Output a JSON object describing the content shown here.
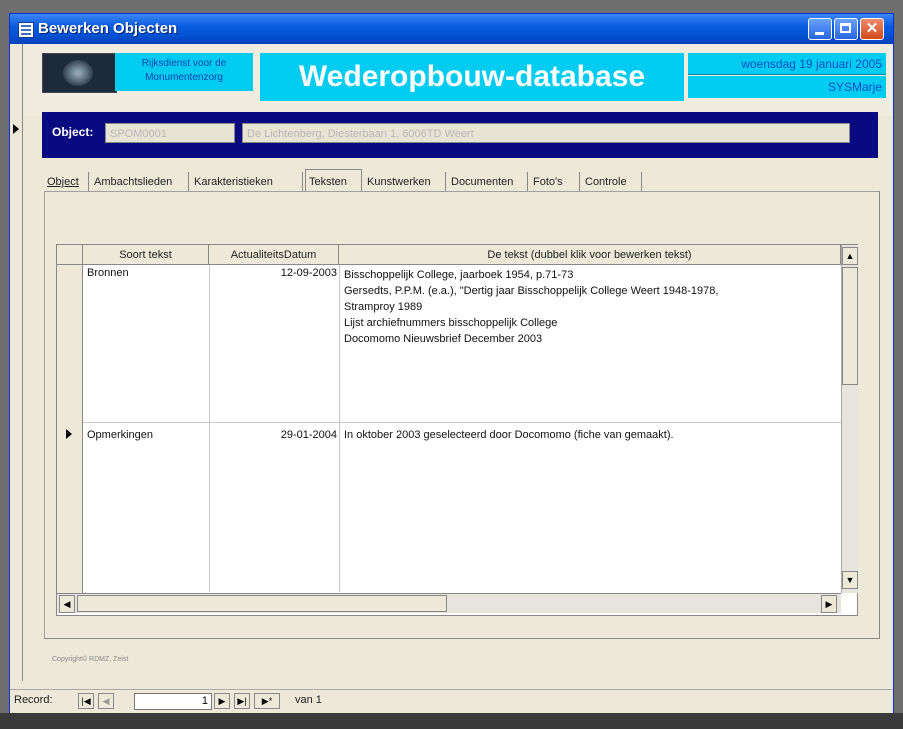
{
  "window": {
    "title": "Bewerken Objecten"
  },
  "header": {
    "org_line1": "Rijksdienst voor de",
    "org_line2": "Monumentenzorg",
    "db_title": "Wederopbouw-database",
    "date": "woensdag 19 januari 2005",
    "user": "SYSMarje"
  },
  "object": {
    "label": "Object:",
    "code": "SPOM0001",
    "address": "De Lichtenberg, Diesterbaan 1, 6006TD Weert"
  },
  "tabs": [
    {
      "label": "Object"
    },
    {
      "label": "Ambachtslieden"
    },
    {
      "label": "Karakteristieken"
    },
    {
      "label": "Teksten"
    },
    {
      "label": "Kunstwerken"
    },
    {
      "label": "Documenten"
    },
    {
      "label": "Foto's"
    },
    {
      "label": "Controle"
    }
  ],
  "grid": {
    "columns": [
      "Soort tekst",
      "ActualiteitsDatum",
      "De tekst (dubbel klik voor bewerken tekst)"
    ],
    "rows": [
      {
        "soort": "Bronnen",
        "datum": "12-09-2003",
        "tekst_lines": [
          "Bisschoppelijk College, jaarboek 1954, p.71-73",
          "Gersedts, P.P.M. (e.a.), \"Dertig jaar Bisschoppelijk College Weert 1948-1978,",
          "Stramproy 1989",
          "Lijst archiefnummers bisschoppelijk College",
          "Docomomo Nieuwsbrief December 2003"
        ]
      },
      {
        "soort": "Opmerkingen",
        "datum": "29-01-2004",
        "tekst_lines": [
          "In oktober 2003 geselecteerd door Docomomo (fiche van gemaakt)."
        ]
      }
    ]
  },
  "footer": {
    "copyright": "Copyright© RDMZ, Zeist"
  },
  "nav": {
    "label": "Record:",
    "current": "1",
    "van_label": "van 1"
  },
  "colors": {
    "title_bar": "#0552d4",
    "accent_cyan": "#00ccf2",
    "object_bar": "#0a0a80"
  },
  "icons": [
    "table-icon",
    "minimize-icon",
    "maximize-icon",
    "close-icon",
    "record-pointer-icon"
  ]
}
